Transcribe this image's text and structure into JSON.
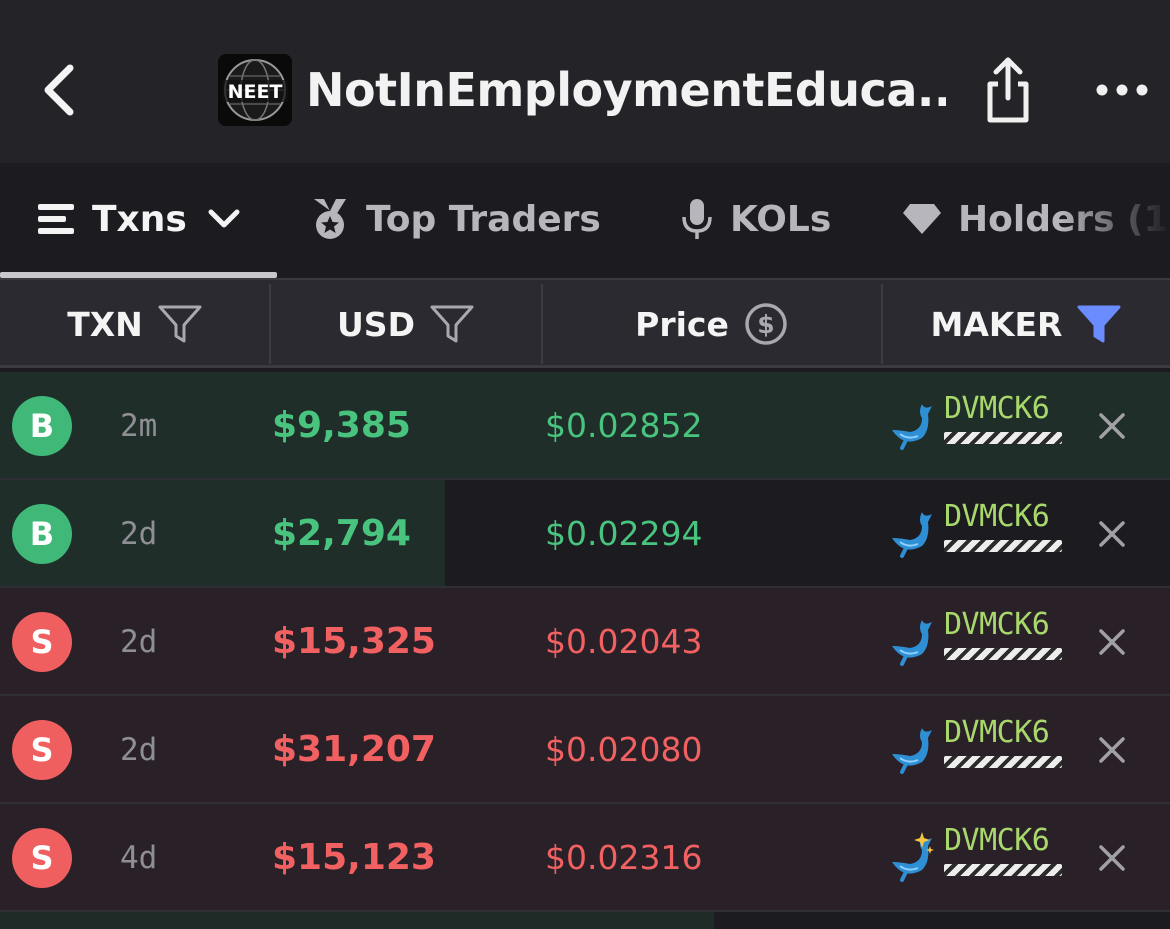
{
  "header": {
    "title": "NotInEmploymentEduca...",
    "logo_text": "NEET"
  },
  "tabs": [
    {
      "label": "Txns",
      "active": true
    },
    {
      "label": "Top Traders",
      "active": false
    },
    {
      "label": "KOLs",
      "active": false
    },
    {
      "label": "Holders (1",
      "active": false
    }
  ],
  "columns": {
    "txn": "TXN",
    "usd": "USD",
    "price": "Price",
    "maker": "MAKER"
  },
  "colors": {
    "buy": "#49c47f",
    "sell": "#f26161",
    "maker_filter_active": "#6b8cff",
    "maker_address": "#a8d86b"
  },
  "rows": [
    {
      "type": "B",
      "side": "buy",
      "age": "2m",
      "usd": "$9,385",
      "price": "$0.02852",
      "maker": "DVMCK6",
      "maker_icon": "whale-icon",
      "usd_fill": 1.0
    },
    {
      "type": "B",
      "side": "buy",
      "age": "2d",
      "usd": "$2,794",
      "price": "$0.02294",
      "maker": "DVMCK6",
      "maker_icon": "whale-icon",
      "usd_fill": 0.38
    },
    {
      "type": "S",
      "side": "sell",
      "age": "2d",
      "usd": "$15,325",
      "price": "$0.02043",
      "maker": "DVMCK6",
      "maker_icon": "whale-icon",
      "usd_fill": 1.0
    },
    {
      "type": "S",
      "side": "sell",
      "age": "2d",
      "usd": "$31,207",
      "price": "$0.02080",
      "maker": "DVMCK6",
      "maker_icon": "whale-icon",
      "usd_fill": 1.0
    },
    {
      "type": "S",
      "side": "sell",
      "age": "4d",
      "usd": "$15,123",
      "price": "$0.02316",
      "maker": "DVMCK6",
      "maker_icon": "whale-sparkle-icon",
      "usd_fill": 1.0
    }
  ]
}
